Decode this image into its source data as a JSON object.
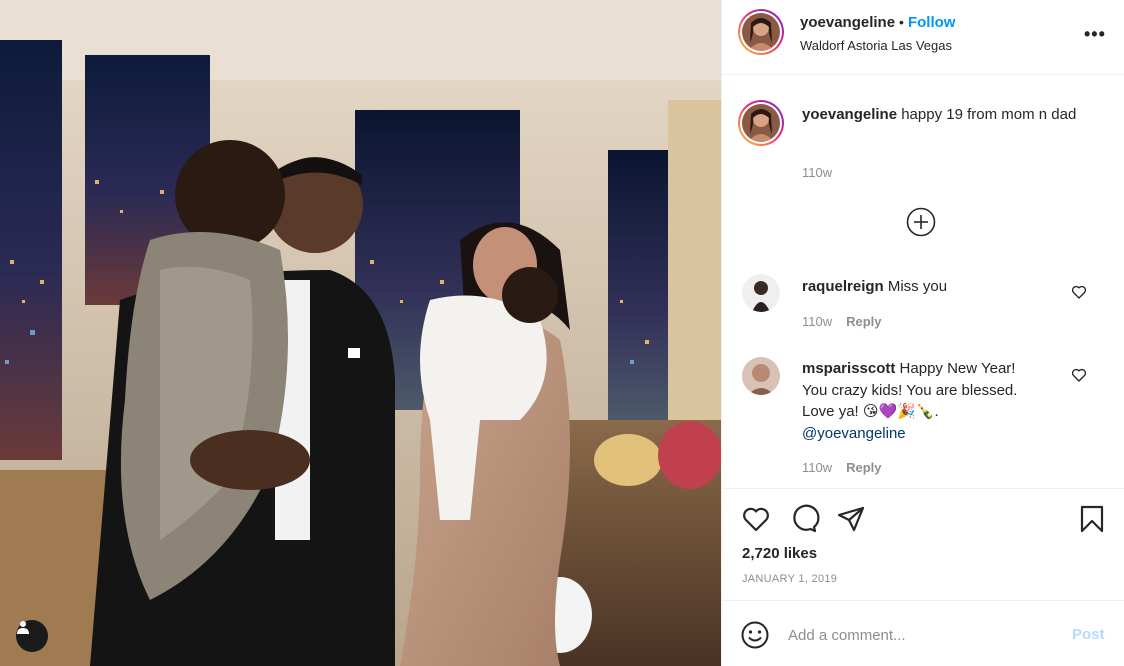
{
  "post": {
    "username": "yoevangeline",
    "follow_label": "Follow",
    "location": "Waldorf Astoria Las Vegas",
    "more_label": "•••"
  },
  "caption": {
    "username": "yoevangeline",
    "text": "happy 19 from mom n dad",
    "time": "110w"
  },
  "comments": [
    {
      "username": "raquelreign",
      "text": "Miss you",
      "time": "110w",
      "reply_label": "Reply"
    },
    {
      "username": "msparisscott",
      "text_line1": "Happy New Year!",
      "text_line2": "You crazy kids! You are blessed.",
      "text_line3": "Love ya! 😘💜🎉🍾.",
      "mention": "@yoevangeline",
      "time": "110w",
      "reply_label": "Reply"
    }
  ],
  "likes": "2,720 likes",
  "date": "JANUARY 1, 2019",
  "add_comment": {
    "placeholder": "Add a comment...",
    "post_label": "Post"
  },
  "colors": {
    "accent": "#0095f6",
    "post_disabled": "#b3dbff",
    "meta": "#8e8e8e"
  },
  "icons": [
    "user-tag-icon",
    "more-icon",
    "add-circle-icon",
    "heart-icon",
    "comment-icon",
    "share-icon",
    "bookmark-icon",
    "emoji-icon"
  ]
}
